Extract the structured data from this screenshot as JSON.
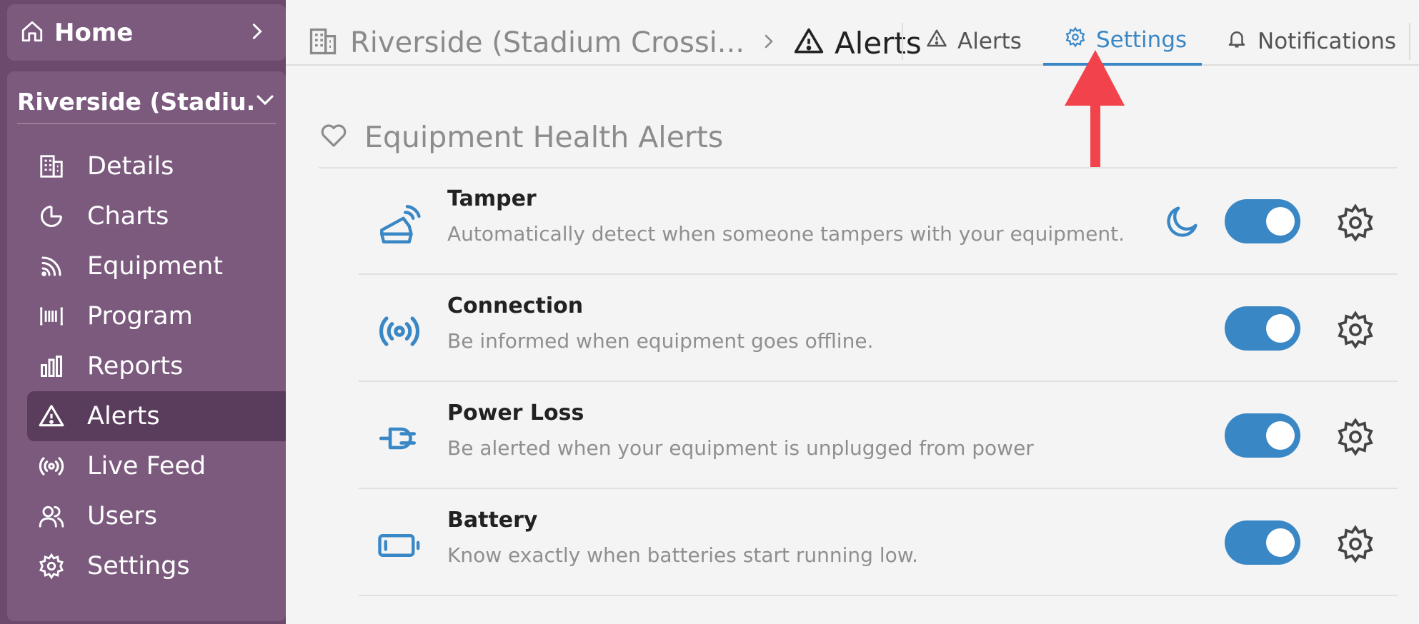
{
  "sidebar": {
    "home_label": "Home",
    "location_label": "Riverside (Stadiu...",
    "items": [
      {
        "label": "Details",
        "icon": "building-icon"
      },
      {
        "label": "Charts",
        "icon": "pie-chart-icon"
      },
      {
        "label": "Equipment",
        "icon": "signal-icon"
      },
      {
        "label": "Program",
        "icon": "barcode-icon"
      },
      {
        "label": "Reports",
        "icon": "bar-chart-icon"
      },
      {
        "label": "Alerts",
        "icon": "warning-icon",
        "active": true
      },
      {
        "label": "Live Feed",
        "icon": "broadcast-icon"
      },
      {
        "label": "Users",
        "icon": "users-icon"
      },
      {
        "label": "Settings",
        "icon": "gear-icon"
      }
    ]
  },
  "header": {
    "breadcrumb_site": "Riverside (Stadium Crossi...",
    "breadcrumb_current": "Alerts",
    "tabs": [
      {
        "label": "Alerts",
        "icon": "warning-icon"
      },
      {
        "label": "Settings",
        "icon": "gear-icon",
        "selected": true
      },
      {
        "label": "Notifications",
        "icon": "bell-icon"
      }
    ]
  },
  "section": {
    "title": "Equipment Health Alerts",
    "icon": "heart-icon"
  },
  "alerts": [
    {
      "title": "Tamper",
      "description": "Automatically detect when someone tampers with your equipment.",
      "icon": "tamper-icon",
      "enabled": true,
      "has_moon": true
    },
    {
      "title": "Connection",
      "description": "Be informed when equipment goes offline.",
      "icon": "broadcast-icon",
      "enabled": true
    },
    {
      "title": "Power Loss",
      "description": "Be alerted when your equipment is unplugged from power",
      "icon": "plug-icon",
      "enabled": true
    },
    {
      "title": "Battery",
      "description": "Know exactly when batteries start running low.",
      "icon": "battery-icon",
      "enabled": true
    }
  ],
  "colors": {
    "sidebar_bg": "#6b4a6e",
    "accent": "#3a87c6",
    "annotation_arrow": "#f2424b"
  }
}
